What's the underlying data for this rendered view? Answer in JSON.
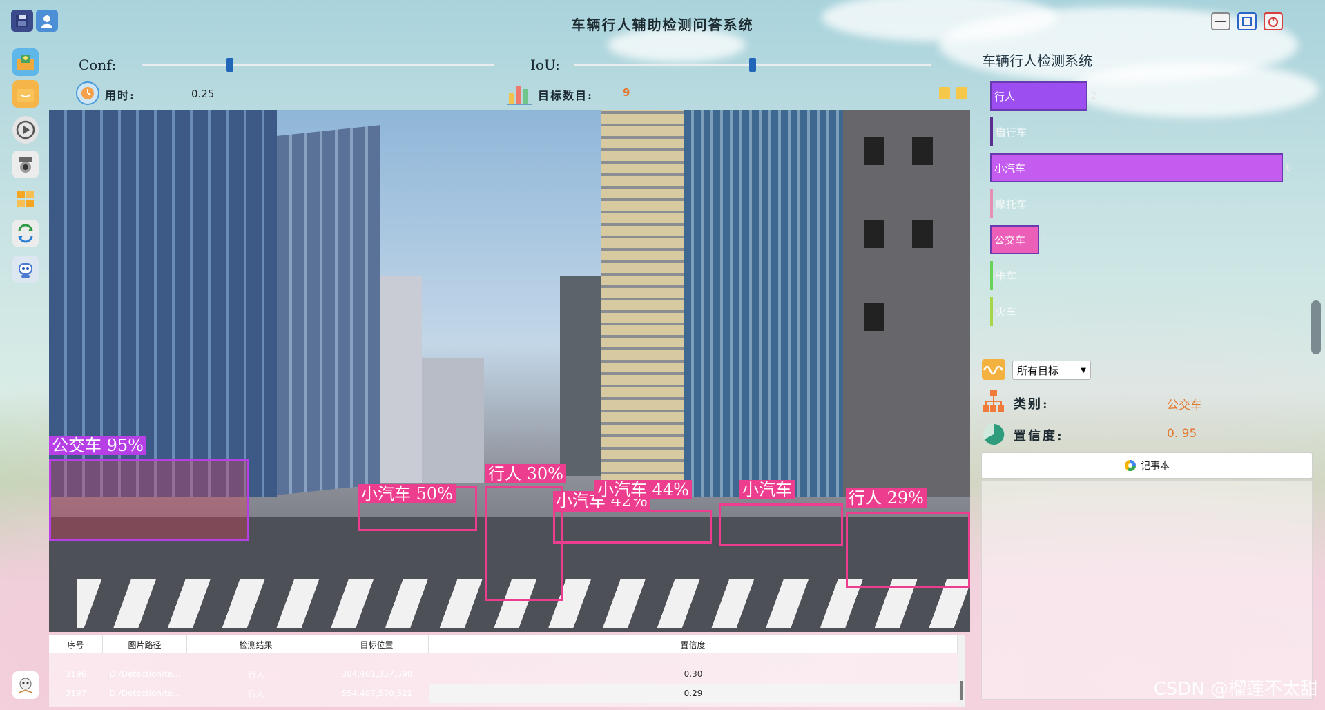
{
  "app": {
    "title": "车辆行人辅助检测问答系统"
  },
  "sliders": {
    "conf": {
      "label": "Conf:",
      "value": 0.25
    },
    "iou": {
      "label": "IoU:",
      "value": 0.5
    }
  },
  "stats": {
    "time_label": "用时:",
    "time_value": "0.25",
    "count_label": "目标数目:",
    "count_value": "9"
  },
  "detections": [
    {
      "label": "公交车 95%",
      "color": "#b640e6"
    },
    {
      "label": "小汽车 50%",
      "color": "#ec3d8e"
    },
    {
      "label": "行人 30%",
      "color": "#ec3d8e"
    },
    {
      "label": "小汽车 42%",
      "color": "#ec3d8e"
    },
    {
      "label": "小汽车 44%",
      "color": "#ec3d8e"
    },
    {
      "label": "小汽车",
      "color": "#ec3d8e"
    },
    {
      "label": "行人 29%",
      "color": "#ec3d8e"
    }
  ],
  "panel": {
    "title": "车辆行人检测系统",
    "classes": [
      {
        "name": "行人",
        "count": 2,
        "color": "#9d4ef0"
      },
      {
        "name": "自行车",
        "count": 0,
        "color": "#5a2d8f"
      },
      {
        "name": "小汽车",
        "count": 6,
        "color": "#c45cf0"
      },
      {
        "name": "摩托车",
        "count": 0,
        "color": "#e690b4"
      },
      {
        "name": "公交车",
        "count": 1,
        "color": "#ec5fb8"
      },
      {
        "name": "卡车",
        "count": 0,
        "color": "#68d35a"
      },
      {
        "name": "火车",
        "count": 0,
        "color": "#a6d64a"
      }
    ],
    "max_count": 6,
    "select_value": "所有目标",
    "category_label": "类别:",
    "category_value": "公交车",
    "confidence_label": "置信度:",
    "confidence_value": "0. 95",
    "notebook_label": "记事本"
  },
  "table": {
    "headers": [
      "序号",
      "图片路径",
      "检测结果",
      "目标位置",
      "置信度"
    ],
    "rows": [
      [
        "3196",
        "D:/Detection/te...",
        "行人",
        "304,461,357,598",
        "0.30"
      ],
      [
        "3197",
        "D:/Detection/te...",
        "行人",
        "554,487,570,521",
        "0.29"
      ]
    ]
  },
  "watermark": "CSDN @榴莲不太甜"
}
